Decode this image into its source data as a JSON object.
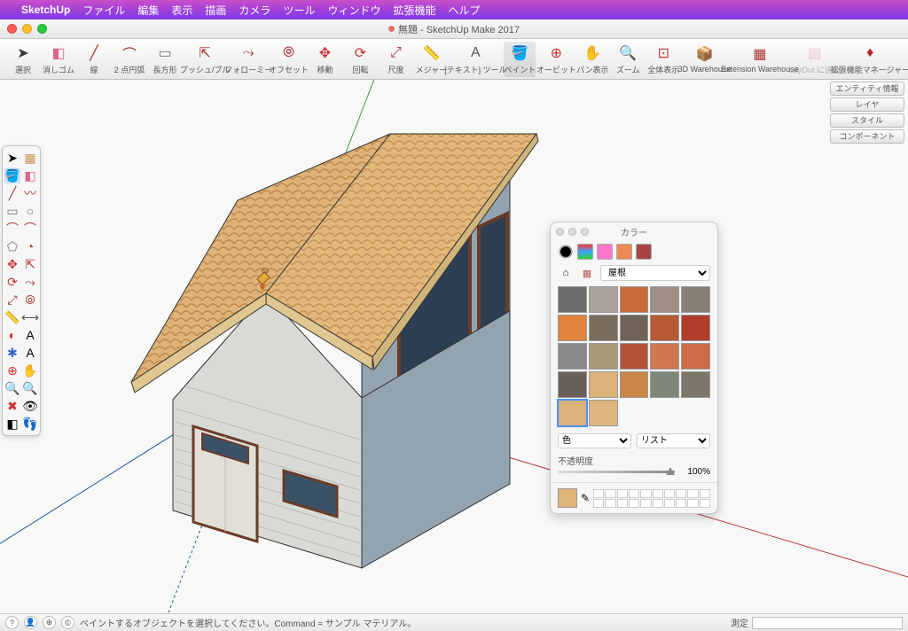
{
  "menubar": {
    "app": "SketchUp",
    "items": [
      "ファイル",
      "編集",
      "表示",
      "描画",
      "カメラ",
      "ツール",
      "ウィンドウ",
      "拡張機能",
      "ヘルプ"
    ]
  },
  "window": {
    "title": "無題 - SketchUp Make 2017"
  },
  "toolbar": [
    {
      "label": "選択",
      "icon": "arrow"
    },
    {
      "label": "消しゴム",
      "icon": "eraser"
    },
    {
      "label": "線",
      "icon": "pencil"
    },
    {
      "label": "2 点円弧",
      "icon": "arc"
    },
    {
      "label": "長方形",
      "icon": "rect"
    },
    {
      "label": "プッシュ/プル",
      "icon": "pushpull"
    },
    {
      "label": "フォローミー",
      "icon": "followme"
    },
    {
      "label": "オフセット",
      "icon": "offset"
    },
    {
      "label": "移動",
      "icon": "move"
    },
    {
      "label": "回転",
      "icon": "rotate"
    },
    {
      "label": "尺度",
      "icon": "scale"
    },
    {
      "label": "メジャー",
      "icon": "tape"
    },
    {
      "label": "[テキスト] ツール",
      "icon": "text"
    },
    {
      "label": "ペイント",
      "icon": "paint",
      "active": true
    },
    {
      "label": "オービット",
      "icon": "orbit"
    },
    {
      "label": "パン表示",
      "icon": "pan"
    },
    {
      "label": "ズーム",
      "icon": "zoom"
    },
    {
      "label": "全体表示",
      "icon": "zoomext"
    },
    {
      "label": "3D Warehouse",
      "icon": "3dw"
    },
    {
      "label": "Extension Warehouse",
      "icon": "ew"
    },
    {
      "label": "LayOut に送信",
      "icon": "layout",
      "disabled": true
    },
    {
      "label": "拡張機能マネージャー",
      "icon": "extmgr"
    }
  ],
  "tray": [
    "エンティティ情報",
    "レイヤ",
    "スタイル",
    "コンポーネント"
  ],
  "color_panel": {
    "title": "カラー",
    "category": "屋根",
    "mode": "色",
    "view": "リスト",
    "opacity_label": "不透明度",
    "opacity_value": "100%",
    "swatches": [
      {
        "bg": "#6c6c6c"
      },
      {
        "bg": "#a9a39a"
      },
      {
        "bg": "#c96b3a"
      },
      {
        "bg": "#a08f85"
      },
      {
        "bg": "#8a7f74"
      },
      {
        "bg": "#e2843d"
      },
      {
        "bg": "#7a6e5f"
      },
      {
        "bg": "#6f6256"
      },
      {
        "bg": "#b65a34"
      },
      {
        "bg": "#b23d2c"
      },
      {
        "bg": "#8a8a8a"
      },
      {
        "bg": "#a89c78"
      },
      {
        "bg": "#b35438"
      },
      {
        "bg": "#cf7850"
      },
      {
        "bg": "#cc6b45"
      },
      {
        "bg": "#6b6058"
      },
      {
        "bg": "#dbb27a",
        "selected": true
      },
      {
        "bg": "#c98546"
      },
      {
        "bg": "#7e8678"
      },
      {
        "bg": "#7c7768"
      }
    ],
    "current": "#e0b57a",
    "last_row_count": 2
  },
  "status": {
    "hint": "ペイントするオブジェクトを選択してください。Command = サンプル マテリアル。",
    "measure_label": "測定"
  }
}
